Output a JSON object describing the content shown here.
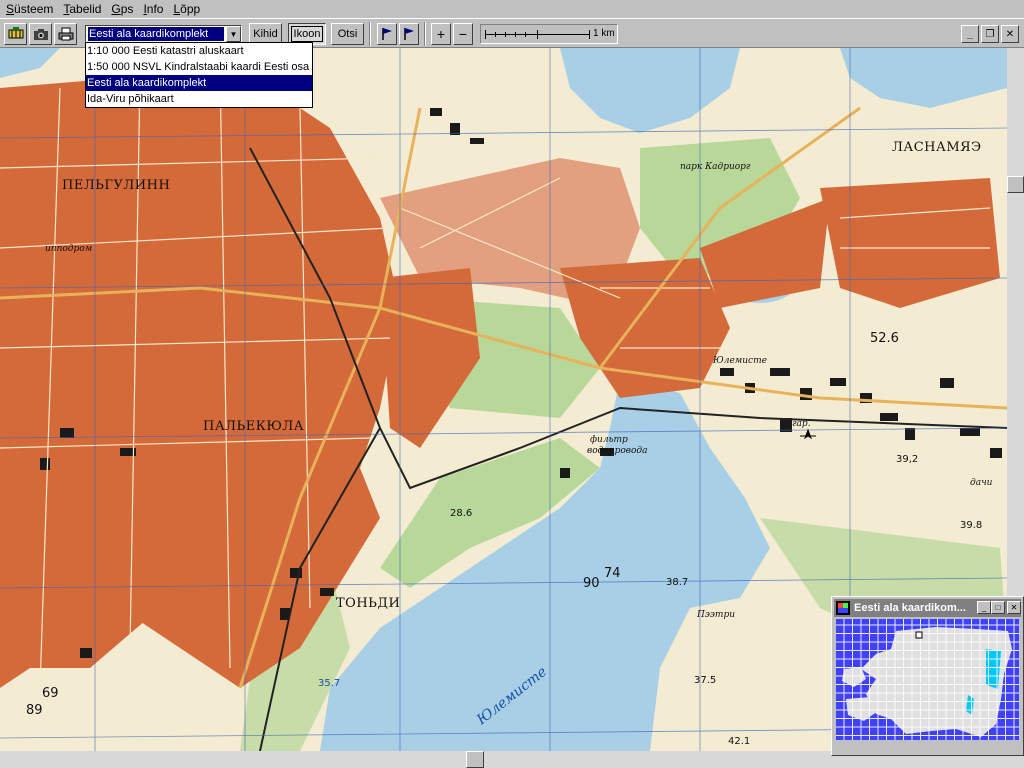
{
  "menu": [
    {
      "label": "Süsteem",
      "hotkey": "S",
      "rest": "üsteem"
    },
    {
      "label": "Tabelid",
      "hotkey": "T",
      "rest": "abelid"
    },
    {
      "label": "Gps",
      "hotkey": "G",
      "rest": "ps"
    },
    {
      "label": "Info",
      "hotkey": "I",
      "rest": "nfo"
    },
    {
      "label": "Lõpp",
      "hotkey": "L",
      "rest": "õpp"
    }
  ],
  "toolbar": {
    "map_select_value": "Eesti ala kaardikomplekt",
    "layers_label": "Kihid",
    "icon_label": "Ikoon",
    "search_label": "Otsi",
    "zoom_in": "+",
    "zoom_out": "−",
    "scale_label": "1 km",
    "icons": [
      "map-tool-icon",
      "camera-icon",
      "printer-icon",
      "flag-icon",
      "flag-icon"
    ]
  },
  "window_controls": {
    "minimize": "_",
    "restore": "❐",
    "close": "✕"
  },
  "dropdown": {
    "items": [
      "1:10 000 Eesti katastri aluskaart",
      "1:50 000 NSVL Kindralstaabi kaardi Eesti osa",
      "Eesti ala kaardikomplekt",
      "Ida-Viru põhikaart"
    ],
    "selected_index": 2
  },
  "map": {
    "colors": {
      "urban": "#d4693a",
      "paper": "#f4ecd2",
      "water": "#a8cfe6",
      "green": "#b8d89a",
      "grid": "#3a66b8",
      "road": "#e8b25a"
    },
    "labels": [
      {
        "text": "ПЕЛЬГУЛИНН",
        "style": "big"
      },
      {
        "text": "ЛАСНАМЯЭ",
        "style": "big"
      },
      {
        "text": "ПАЛЬЕКЮЛА",
        "style": "big"
      },
      {
        "text": "ТОНЬДИ",
        "style": "big"
      },
      {
        "text": "Юлемисте",
        "style": "small"
      },
      {
        "text": "фильтр",
        "style": "small"
      },
      {
        "text": "водопровода",
        "style": "small"
      },
      {
        "text": "парк Кадриорг",
        "style": "small"
      },
      {
        "text": "ипподром",
        "style": "small"
      },
      {
        "text": "дачи",
        "style": "small"
      },
      {
        "text": "Пээтри",
        "style": "small"
      },
      {
        "text": "гар.",
        "style": "small"
      },
      {
        "text": "52.6",
        "style": "num"
      },
      {
        "text": "39,2",
        "style": "num"
      },
      {
        "text": "39.8",
        "style": "num"
      },
      {
        "text": "28.6",
        "style": "num"
      },
      {
        "text": "38.7",
        "style": "num"
      },
      {
        "text": "37.5",
        "style": "num"
      },
      {
        "text": "42.1",
        "style": "num"
      },
      {
        "text": "35.7",
        "style": "num"
      },
      {
        "text": "90",
        "style": "num"
      },
      {
        "text": "74",
        "style": "num"
      },
      {
        "text": "69",
        "style": "num"
      },
      {
        "text": "89",
        "style": "num"
      },
      {
        "text": "Юлемисте",
        "style": "water"
      }
    ]
  },
  "overview": {
    "title": "Eesti ala kaardikom...",
    "buttons": {
      "minimize": "_",
      "maximize": "□",
      "close": "✕"
    },
    "colors": {
      "sea": "#4040ff",
      "land": "#e0e0e0",
      "lake": "#00c8ff"
    }
  }
}
